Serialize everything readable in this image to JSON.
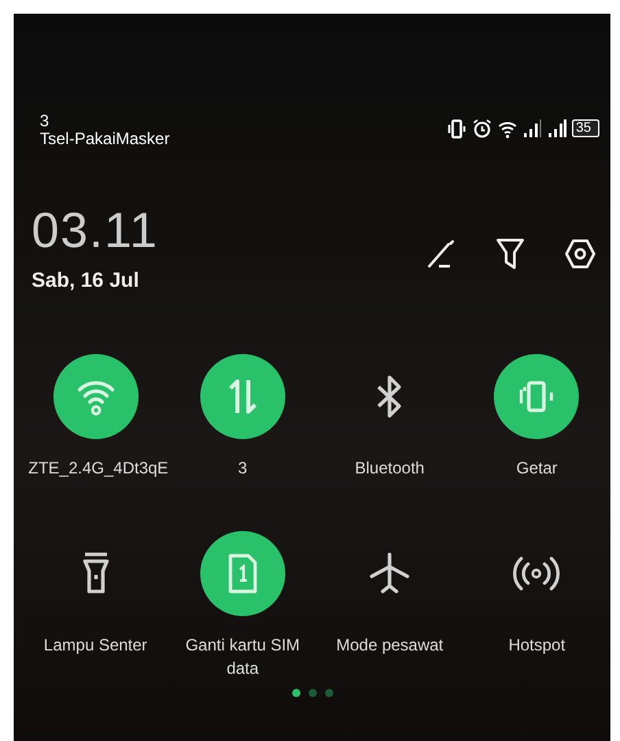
{
  "status_bar": {
    "sim_slot": "3",
    "carrier": "Tsel-PakaiMasker",
    "battery": "35"
  },
  "clock": {
    "time": "03.11",
    "date": "Sab, 16 Jul"
  },
  "tiles": [
    {
      "kind": "wifi",
      "label": "ZTE_2.4G_4Dt3qE",
      "on": true
    },
    {
      "kind": "data",
      "label": "3",
      "on": true
    },
    {
      "kind": "bluetooth",
      "label": "Bluetooth",
      "on": false
    },
    {
      "kind": "vibrate",
      "label": "Getar",
      "on": true
    },
    {
      "kind": "flashlight",
      "label": "Lampu Senter",
      "on": false
    },
    {
      "kind": "sim",
      "label": "Ganti kartu SIM data",
      "on": true
    },
    {
      "kind": "airplane",
      "label": "Mode pesawat",
      "on": false
    },
    {
      "kind": "hotspot",
      "label": "Hotspot",
      "on": false
    }
  ],
  "pages": [
    {
      "selected": true
    },
    {
      "selected": false
    },
    {
      "selected": false
    }
  ]
}
